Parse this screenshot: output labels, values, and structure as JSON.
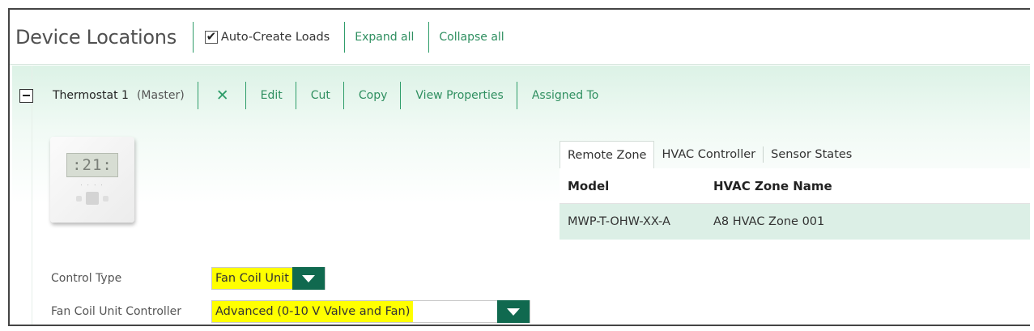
{
  "header": {
    "title": "Device Locations",
    "auto_create_label": "Auto-Create Loads",
    "auto_create_checked": true,
    "expand_all": "Expand all",
    "collapse_all": "Collapse all"
  },
  "device": {
    "name": "Thermostat 1",
    "role": "(Master)",
    "delete_glyph": "✕",
    "edit": "Edit",
    "cut": "Cut",
    "copy": "Copy",
    "view_properties": "View Properties",
    "assigned_to": "Assigned To",
    "display_reading": ":21:"
  },
  "tabs": [
    "Remote Zone",
    "HVAC Controller",
    "Sensor States"
  ],
  "table": {
    "headers": [
      "Model",
      "HVAC Zone Name"
    ],
    "rows": [
      [
        "MWP-T-OHW-XX-A",
        "A8 HVAC Zone 001"
      ]
    ]
  },
  "form": {
    "control_type_label": "Control Type",
    "control_type_value": "Fan Coil Unit",
    "fcu_controller_label": "Fan Coil Unit Controller",
    "fcu_controller_value": "Advanced (0-10 V Valve and Fan)"
  },
  "colors": {
    "accent": "#2f8f60",
    "dropdown_arrow_bg": "#10694f",
    "highlight": "#ffff00",
    "content_bg": "#dcf2e6"
  }
}
